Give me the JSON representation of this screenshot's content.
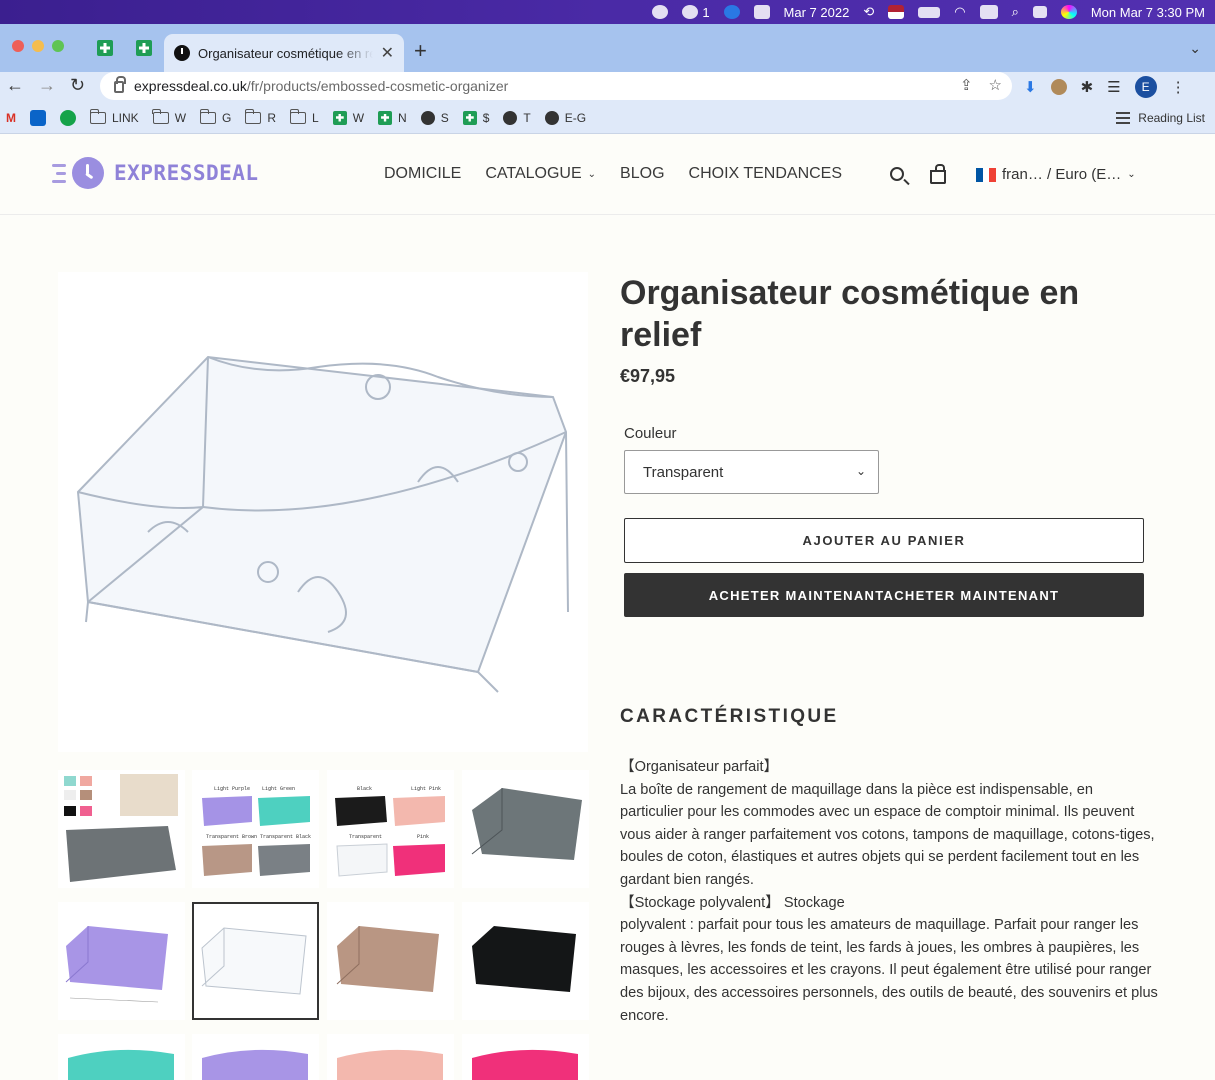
{
  "menubar": {
    "notification_count": "1",
    "date": "Mar 7 2022",
    "datetime": "Mon Mar 7  3:30 PM"
  },
  "browser": {
    "tab_title": "Organisateur cosmétique en relief",
    "url_host": "expressdeal.co.uk",
    "url_path": "/fr/products/embossed-cosmetic-organizer",
    "profile_initial": "E",
    "bookmarks": [
      {
        "icon": "gmail-icon",
        "label": ""
      },
      {
        "icon": "outlook-icon",
        "label": ""
      },
      {
        "icon": "grammarly-icon",
        "label": ""
      },
      {
        "icon": "folder-icon",
        "label": "LINK"
      },
      {
        "icon": "folder-icon",
        "label": "W"
      },
      {
        "icon": "folder-icon",
        "label": "G"
      },
      {
        "icon": "folder-icon",
        "label": "R"
      },
      {
        "icon": "folder-icon",
        "label": "L"
      },
      {
        "icon": "sheets-icon",
        "label": "W"
      },
      {
        "icon": "sheets-icon",
        "label": "N"
      },
      {
        "icon": "globe-icon",
        "label": "S"
      },
      {
        "icon": "sheets-icon",
        "label": "$"
      },
      {
        "icon": "globe-icon",
        "label": "T"
      },
      {
        "icon": "globe-icon",
        "label": "E-G"
      }
    ],
    "reading_list": "Reading List"
  },
  "site": {
    "logo_text": "EXPRESSDEAL",
    "nav": [
      "DOMICILE",
      "CATALOGUE",
      "BLOG",
      "CHOIX TENDANCES"
    ],
    "locale": "fran…  / Euro (E…",
    "colors": {
      "logo": "#8f82d8",
      "dark_button": "#333333",
      "flag_blue": "#0055a4",
      "flag_red": "#ef4135"
    }
  },
  "product": {
    "title": "Organisateur cosmétique en relief",
    "price": "€97,95",
    "variant_label": "Couleur",
    "variant_selected": "Transparent",
    "add_to_cart": "AJOUTER AU PANIER",
    "buy_now": "ACHETER MAINTENANTACHETER MAINTENANT",
    "section_heading": "CARACTÉRISTIQUE",
    "description": [
      "【Organisateur parfait】",
      "La boîte de rangement de maquillage dans la pièce est indispensable, en particulier pour les commodes avec un espace de comptoir minimal. Ils peuvent vous aider à ranger parfaitement vos cotons, tampons de maquillage, cotons-tiges, boules de coton, élastiques et autres objets qui se perdent facilement tout en les gardant bien rangés.",
      "【Stockage polyvalent】 Stockage",
      "polyvalent : parfait pour tous les amateurs de maquillage. Parfait pour ranger les rouges à lèvres, les fonds de teint, les fards à joues, les ombres à paupières, les masques, les accessoires et les crayons. Il peut également être utilisé pour ranger des bijoux, des accessoires personnels, des outils de beauté, des souvenirs et plus encore."
    ],
    "thumb_labels": {
      "t2": [
        "Light Purple",
        "Light Green",
        "Transparent Brown",
        "Transparent Black"
      ],
      "t3": [
        "Black",
        "Light Pink",
        "Transparent",
        "Pink"
      ]
    }
  }
}
